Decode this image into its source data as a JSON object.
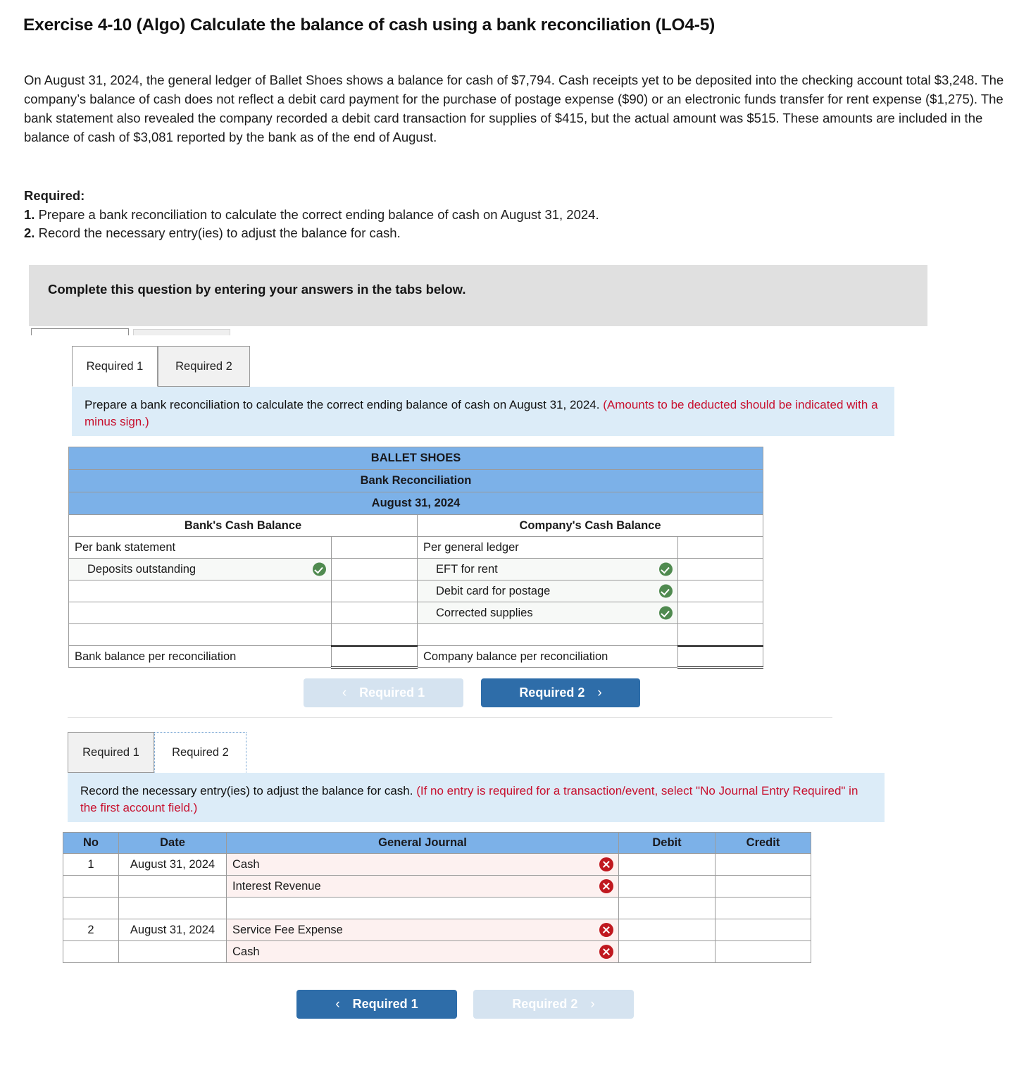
{
  "exercise": {
    "title": "Exercise 4-10 (Algo) Calculate the balance of cash using a bank reconciliation (LO4-5)",
    "problem_text": "On August 31, 2024, the general ledger of Ballet Shoes shows a balance for cash of $7,794. Cash receipts yet to be deposited into the checking account total $3,248. The company’s balance of cash does not reflect a debit card payment for the purchase of postage expense ($90) or an electronic funds transfer for rent expense ($1,275). The bank statement also revealed the company recorded a debit card transaction for supplies of $415, but the actual amount was $515. These amounts are included in the balance of cash of $3,081 reported by the bank as of the end of August.",
    "required_heading": "Required:",
    "requirements": [
      {
        "num": "1.",
        "text": " Prepare a bank reconciliation to calculate the correct ending balance of cash on August 31, 2024."
      },
      {
        "num": "2.",
        "text": " Record the necessary entry(ies) to adjust the balance for cash."
      }
    ]
  },
  "banner": {
    "text": "Complete this question by entering your answers in the tabs below."
  },
  "panel1": {
    "tabs": [
      {
        "label": "Required 1",
        "state": "active"
      },
      {
        "label": "Required 2",
        "state": "inactive"
      }
    ],
    "instruction": {
      "main": "Prepare a bank reconciliation to calculate the correct ending balance of cash on August 31, 2024. ",
      "hint": "(Amounts to be deducted should be indicated with a minus sign.)"
    },
    "table": {
      "title_lines": [
        "BALLET SHOES",
        "Bank Reconciliation",
        "August 31, 2024"
      ],
      "column_headers": [
        "Bank's Cash Balance",
        "Company's Cash Balance"
      ],
      "rows": [
        {
          "left_label": "Per bank statement",
          "left_indent": false,
          "left_icon": "",
          "left_amount": "",
          "right_label": "Per general ledger",
          "right_indent": false,
          "right_icon": "",
          "right_amount": ""
        },
        {
          "left_label": "Deposits outstanding",
          "left_indent": true,
          "left_icon": "check-icon",
          "left_amount": "",
          "right_label": "EFT for rent",
          "right_indent": true,
          "right_icon": "check-icon",
          "right_amount": ""
        },
        {
          "left_label": "",
          "left_indent": true,
          "left_icon": "",
          "left_amount": "",
          "right_label": "Debit card for postage",
          "right_indent": true,
          "right_icon": "check-icon",
          "right_amount": ""
        },
        {
          "left_label": "",
          "left_indent": true,
          "left_icon": "",
          "left_amount": "",
          "right_label": "Corrected supplies",
          "right_indent": true,
          "right_icon": "check-icon",
          "right_amount": ""
        },
        {
          "left_label": "",
          "left_indent": false,
          "left_icon": "",
          "left_amount": "",
          "right_label": "",
          "right_indent": false,
          "right_icon": "",
          "right_amount": ""
        }
      ],
      "total_row": {
        "left_label": "Bank balance per reconciliation",
        "left_amount": "",
        "right_label": "Company balance per reconciliation",
        "right_amount": ""
      }
    },
    "nav": {
      "prev": {
        "label": "Required 1",
        "arrow": "‹",
        "state": "disabled"
      },
      "next": {
        "label": "Required 2",
        "arrow": "›",
        "state": "enabled"
      }
    }
  },
  "panel2": {
    "tabs": [
      {
        "label": "Required 1",
        "state": "inactive"
      },
      {
        "label": "Required 2",
        "state": "focus"
      }
    ],
    "instruction": {
      "main": "Record the necessary entry(ies) to adjust the balance for cash. ",
      "hint": "(If no entry is required for a transaction/event, select \"No Journal Entry Required\" in the first account field.)"
    },
    "journal": {
      "headers": [
        "No",
        "Date",
        "General Journal",
        "Debit",
        "Credit"
      ],
      "rows": [
        {
          "no": "1",
          "date": "August 31, 2024",
          "account": "Cash",
          "icon": "x-icon",
          "debit": "",
          "credit": "",
          "filled": true
        },
        {
          "no": "",
          "date": "",
          "account": "Interest Revenue",
          "icon": "x-icon",
          "debit": "",
          "credit": "",
          "filled": true
        },
        {
          "no": "",
          "date": "",
          "account": "",
          "icon": "",
          "debit": "",
          "credit": "",
          "filled": false
        },
        {
          "no": "2",
          "date": "August 31, 2024",
          "account": "Service Fee Expense",
          "icon": "x-icon",
          "debit": "",
          "credit": "",
          "filled": true
        },
        {
          "no": "",
          "date": "",
          "account": "Cash",
          "icon": "x-icon",
          "debit": "",
          "credit": "",
          "filled": true
        }
      ]
    },
    "nav": {
      "prev": {
        "label": "Required 1",
        "arrow": "‹",
        "state": "enabled"
      },
      "next": {
        "label": "Required 2",
        "arrow": "›",
        "state": "disabled"
      }
    }
  },
  "colors": {
    "table_header_blue": "#7cb1e8",
    "instruction_blue": "#dcecf8",
    "banner_grey": "#e0e0e0",
    "button_blue": "#2e6da9",
    "button_disabled": "#d5e3f0",
    "hint_red": "#c8102e",
    "check_green": "#4f8a4f",
    "x_red": "#c0181f"
  }
}
